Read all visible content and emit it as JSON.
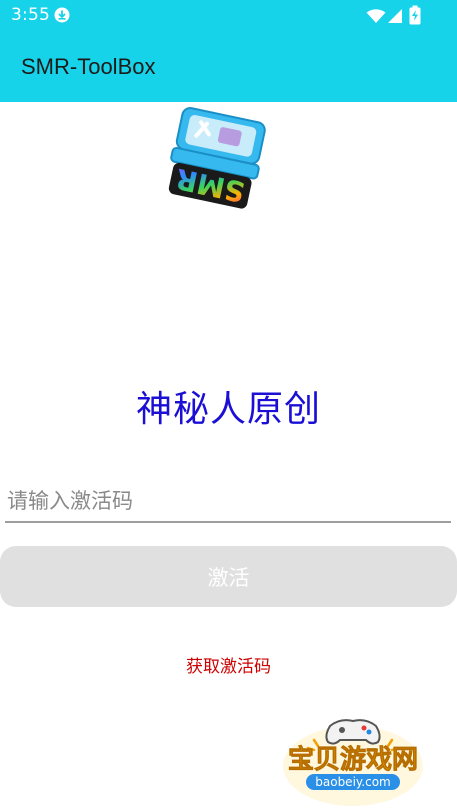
{
  "status_bar": {
    "time": "3:55",
    "icons": [
      "download-icon",
      "wifi-icon",
      "cell-signal-icon",
      "battery-charging-icon"
    ]
  },
  "app_bar": {
    "title": "SMR-ToolBox"
  },
  "logo": {
    "icon": "smr-toolbox-logo",
    "text": "SMR"
  },
  "main": {
    "heading": "神秘人原创",
    "code_input": {
      "placeholder": "请输入激活码",
      "value": ""
    },
    "activate_button": "激活",
    "get_code_link": "获取激活码"
  },
  "watermark": {
    "title": "宝贝游戏网",
    "url": "baobeiy.com"
  },
  "colors": {
    "accent": "#16d3ea",
    "heading": "#1b0fd6",
    "link": "#cc0000",
    "button_disabled": "#e0e0e0"
  }
}
